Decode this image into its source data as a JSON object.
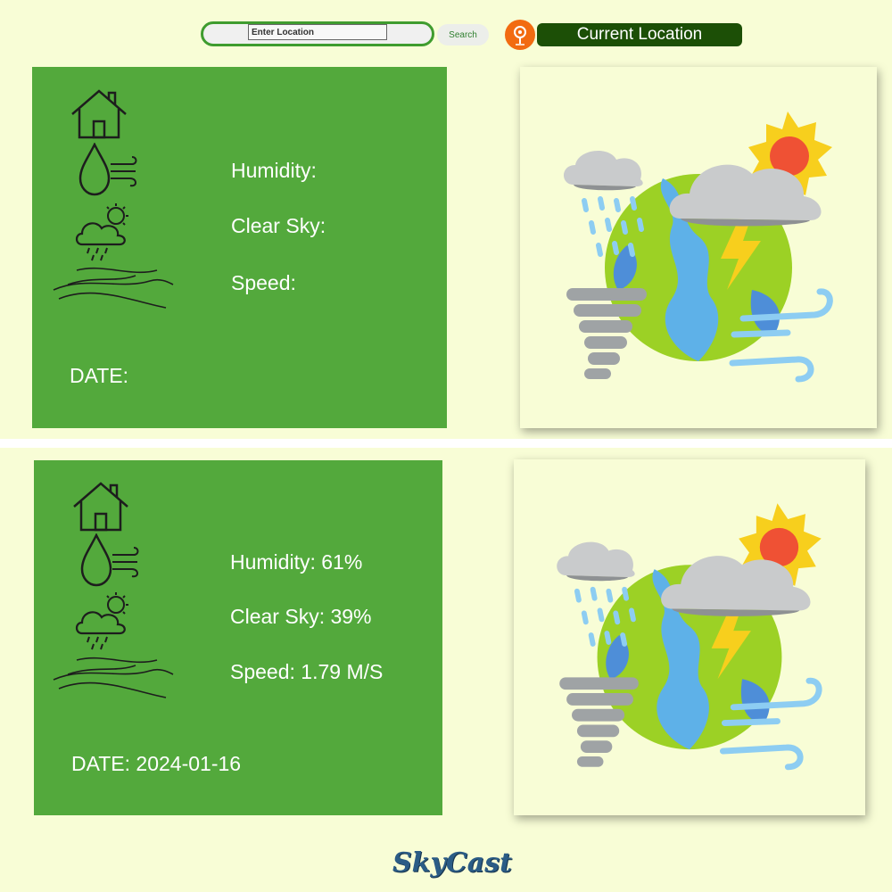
{
  "header": {
    "search_placeholder": "Enter Location",
    "search_button": "Search",
    "location_icon": "location-pin-icon",
    "current_location_button": "Current Location"
  },
  "cards": [
    {
      "humidity_label": "Humidity:",
      "clear_sky_label": "Clear Sky:",
      "speed_label": "Speed:",
      "date_label": "DATE:"
    },
    {
      "humidity_label": "Humidity: 61%",
      "clear_sky_label": "Clear Sky: 39%",
      "speed_label": "Speed: 1.79 M/S",
      "date_label": "DATE: 2024-01-16"
    }
  ],
  "icons": [
    "house-icon",
    "humidity-wind-icon",
    "rain-cloud-sun-icon",
    "wind-waves-icon",
    "weather-globe-illustration"
  ],
  "footer": {
    "logo": "SkyCast"
  },
  "colors": {
    "background": "#f8fdd6",
    "card_green": "#53a93c",
    "dark_green": "#1c4f06",
    "orange": "#f26b11"
  }
}
